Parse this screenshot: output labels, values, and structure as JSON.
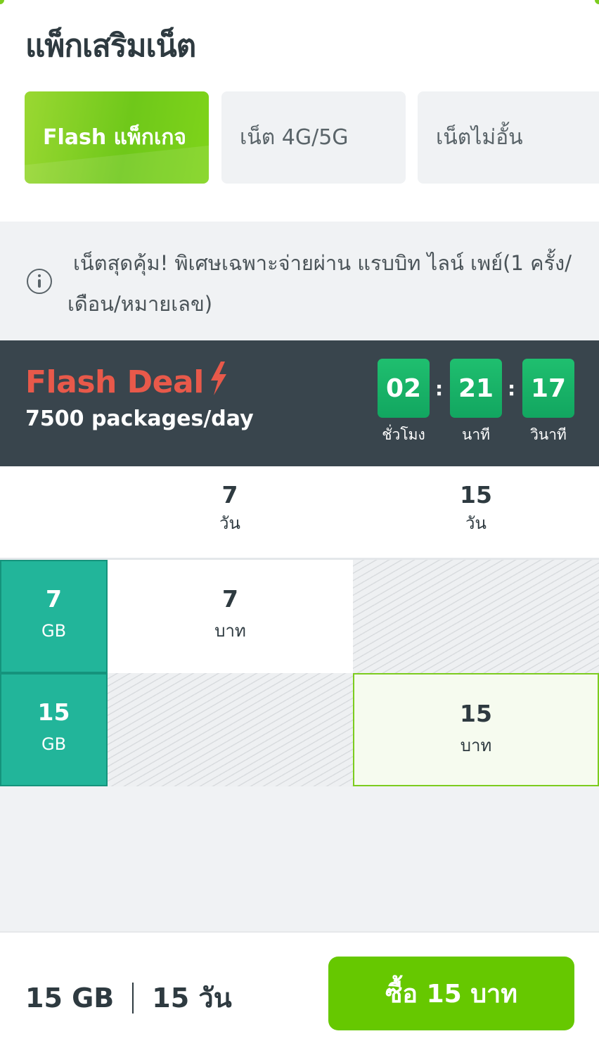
{
  "header": {
    "title": "แพ็กเสริมเน็ต"
  },
  "tabs": [
    {
      "label": "Flash แพ็กเกจ",
      "active": true
    },
    {
      "label": "เน็ต 4G/5G",
      "active": false
    },
    {
      "label": "เน็ตไม่อั้น",
      "active": false
    }
  ],
  "notice": {
    "icon": "info-icon",
    "text": "เน็ตสุดคุ้ม! พิเศษเฉพาะจ่ายผ่าน แรบบิท ไลน์ เพย์(1 ครั้ง/เดือน/หมายเลข)"
  },
  "flash_deal": {
    "title": "Flash Deal",
    "icon": "lightning-bolt-icon",
    "subtitle": "7500 packages/day",
    "timer": {
      "hours": "02",
      "minutes": "21",
      "seconds": "17",
      "hours_label": "ชั่วโมง",
      "minutes_label": "นาที",
      "seconds_label": "วินาที"
    }
  },
  "grid": {
    "columns": [
      {
        "value": "7",
        "unit": "วัน"
      },
      {
        "value": "15",
        "unit": "วัน"
      }
    ],
    "rows": [
      {
        "value": "7",
        "unit": "GB"
      },
      {
        "value": "15",
        "unit": "GB"
      }
    ],
    "cells": [
      {
        "row": 0,
        "col": 0,
        "price": "7",
        "unit": "บาท",
        "available": true,
        "selected": false
      },
      {
        "row": 0,
        "col": 1,
        "available": false
      },
      {
        "row": 1,
        "col": 0,
        "available": false
      },
      {
        "row": 1,
        "col": 1,
        "price": "15",
        "unit": "บาท",
        "available": true,
        "selected": true
      }
    ]
  },
  "summary": {
    "data": "15 GB",
    "duration": "15 วัน"
  },
  "buy_button": {
    "label": "ซื้อ 15 บาท"
  },
  "colors": {
    "accent_green": "#66c800",
    "teal": "#22b59a",
    "flash_red": "#e8594a",
    "timer_green": "#1fbf6f",
    "dark_banner": "#39454d"
  }
}
